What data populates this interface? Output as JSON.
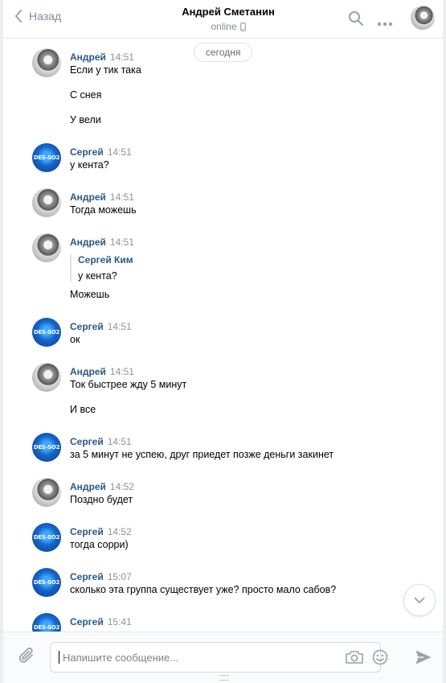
{
  "header": {
    "back_label": "Назад",
    "title": "Андрей Сметанин",
    "status": "online"
  },
  "date_separator": "сегодня",
  "avatar_texts": {
    "sergey": "DES-SO2"
  },
  "messages": [
    {
      "author": "Андрей",
      "time": "14:51",
      "lines": [
        "Если у тик така",
        "С снея",
        "У вели"
      ]
    },
    {
      "author": "Сергей",
      "time": "14:51",
      "lines": [
        "у кента?"
      ]
    },
    {
      "author": "Андрей",
      "time": "14:51",
      "lines": [
        "Тогда можешь"
      ]
    },
    {
      "author": "Андрей",
      "time": "14:51",
      "quote": {
        "author": "Сергей Ким",
        "text": "у кента?"
      },
      "lines": [
        "Можешь"
      ]
    },
    {
      "author": "Сергей",
      "time": "14:51",
      "lines": [
        "ок"
      ]
    },
    {
      "author": "Андрей",
      "time": "14:51",
      "lines": [
        "Ток быстрее жду 5 минут",
        "И все"
      ]
    },
    {
      "author": "Сергей",
      "time": "14:51",
      "lines": [
        "за 5 минут не успею, друг приедет позже деньги закинет"
      ]
    },
    {
      "author": "Андрей",
      "time": "14:52",
      "lines": [
        "Поздно будет"
      ]
    },
    {
      "author": "Сергей",
      "time": "14:52",
      "lines": [
        "тогда сорри)"
      ]
    },
    {
      "author": "Сергей",
      "time": "15:07",
      "lines": [
        "сколько эта группа существует уже? просто мало сабов?"
      ]
    },
    {
      "author": "Сергей",
      "time": "15:41",
      "lines": []
    }
  ],
  "composer": {
    "placeholder": "Напишите сообщение...",
    "value": ""
  },
  "icons": {
    "back": "chevron-left-icon",
    "phone": "mobile-phone-icon",
    "search": "search-icon",
    "more": "more-dots-icon",
    "scroll": "chevron-down-icon",
    "attach": "paperclip-icon",
    "camera": "camera-icon",
    "emoji": "smile-icon",
    "send": "send-icon"
  },
  "colors": {
    "author": "#2a5885",
    "time": "#939393",
    "muted": "#818c99",
    "background": "#edeef0"
  }
}
